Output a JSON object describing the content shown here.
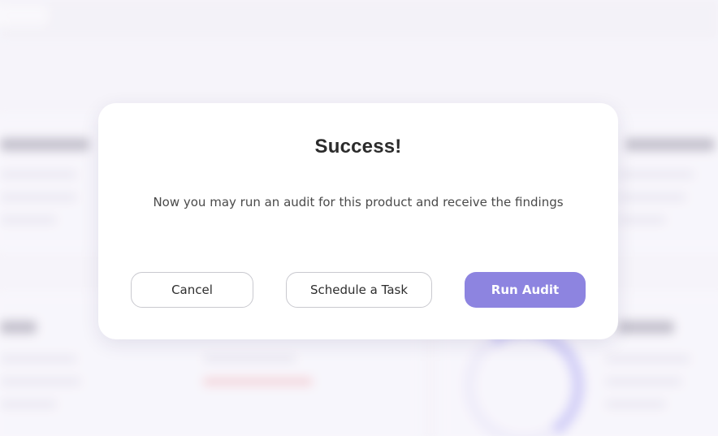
{
  "modal": {
    "title": "Success!",
    "message": "Now you may run an audit for this product and receive the findings",
    "buttons": {
      "cancel": "Cancel",
      "schedule": "Schedule a Task",
      "run_audit": "Run Audit"
    }
  },
  "colors": {
    "primary": "#8d84e0",
    "outline_border": "#c9c9cf",
    "title_text": "#2b2b2b",
    "body_text": "#4a4a4a"
  }
}
